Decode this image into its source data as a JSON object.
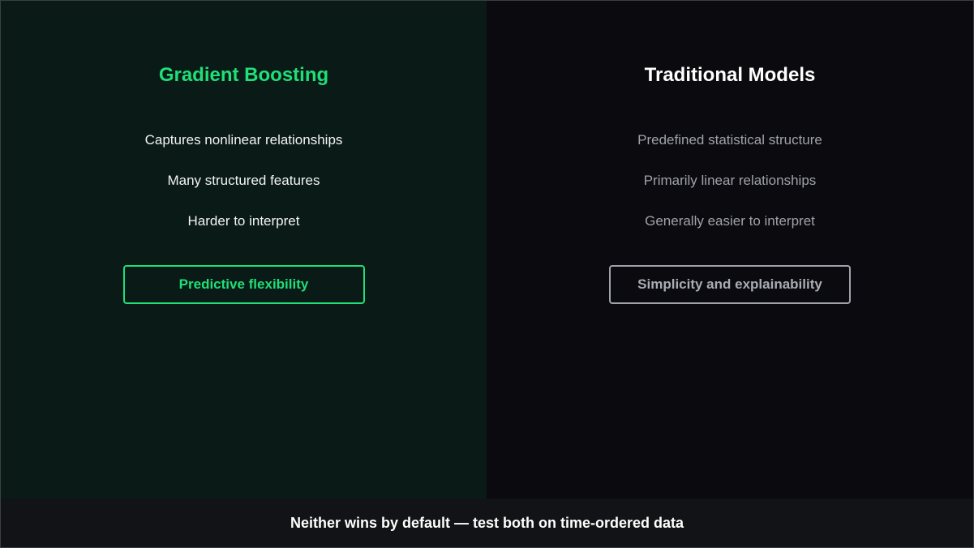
{
  "left_panel": {
    "title": "Gradient Boosting",
    "points": [
      "Captures nonlinear relationships",
      "Many structured features",
      "Harder to interpret"
    ],
    "verdict": "Predictive flexibility",
    "accent_color": "#1fdf78",
    "background_color": "#0a1a17"
  },
  "right_panel": {
    "title": "Traditional Models",
    "points": [
      "Predefined statistical structure",
      "Primarily linear relationships",
      "Generally easier to interpret"
    ],
    "verdict": "Simplicity and explainability",
    "accent_color": "#9fa3a9",
    "background_color": "#0b0a0e"
  },
  "footer": {
    "text": "Neither wins by default — test both on time-ordered data"
  }
}
